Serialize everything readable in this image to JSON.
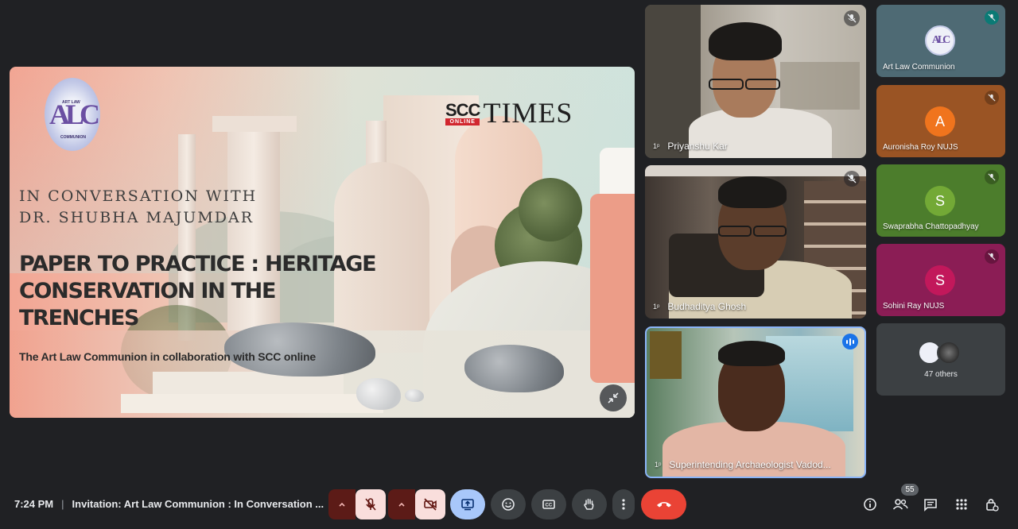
{
  "presentation": {
    "logo_text": "ALC",
    "logo_small_top": "ART LAW",
    "logo_small_side": "COMMUNION",
    "scc_big": "SCC",
    "scc_online": "ONLINE",
    "scc_times": "TIMES",
    "conversation_line1": "IN CONVERSATION WITH",
    "conversation_line2": "DR. SHUBHA  MAJUMDAR",
    "title": "PAPER TO PRACTICE : HERITAGE CONSERVATION IN THE TRENCHES",
    "subtitle": "The Art Law Communion in collaboration with SCC online"
  },
  "videos": [
    {
      "name": "Priyanshu Kar",
      "status": "muted"
    },
    {
      "name": "Budhaditya Ghosh",
      "status": "muted"
    },
    {
      "name": "Superintending Archaeologist Vadod...",
      "status": "speaking"
    }
  ],
  "participants": [
    {
      "name": "Art Law Communion",
      "avatar": "ALC",
      "color": "#4e6a74",
      "muted": true
    },
    {
      "name": "Auronisha Roy NUJS",
      "avatar": "A",
      "color": "#9a5424",
      "avatar_color": "#f0741d",
      "muted": true
    },
    {
      "name": "Swaprabha Chattopadhyay",
      "avatar": "S",
      "color": "#4c7d2c",
      "avatar_color": "#73a936",
      "muted": true
    },
    {
      "name": "Sohini Ray NUJS",
      "avatar": "S",
      "color": "#8b1d55",
      "avatar_color": "#c2185b",
      "muted": true
    }
  ],
  "others": {
    "label": "47 others"
  },
  "bottom_bar": {
    "time": "7:24 PM",
    "separator": "|",
    "meeting_title": "Invitation: Art Law Communion : In Conversation ...",
    "participant_count": "55",
    "icons": {
      "mic": "mic-off-icon",
      "camera": "camera-off-icon",
      "present": "present-screen-icon",
      "reactions": "emoji-icon",
      "captions": "captions-icon",
      "hand": "raise-hand-icon",
      "more": "more-options-icon",
      "leave": "end-call-icon",
      "info": "info-icon",
      "people": "people-icon",
      "chat": "chat-icon",
      "activities": "activities-icon",
      "host": "host-controls-icon"
    },
    "colors": {
      "leave": "#ea4335",
      "present_active": "#a8c7fa",
      "muted_bg": "#f9dedc",
      "muted_arrow_bg": "#5c1b17"
    }
  }
}
